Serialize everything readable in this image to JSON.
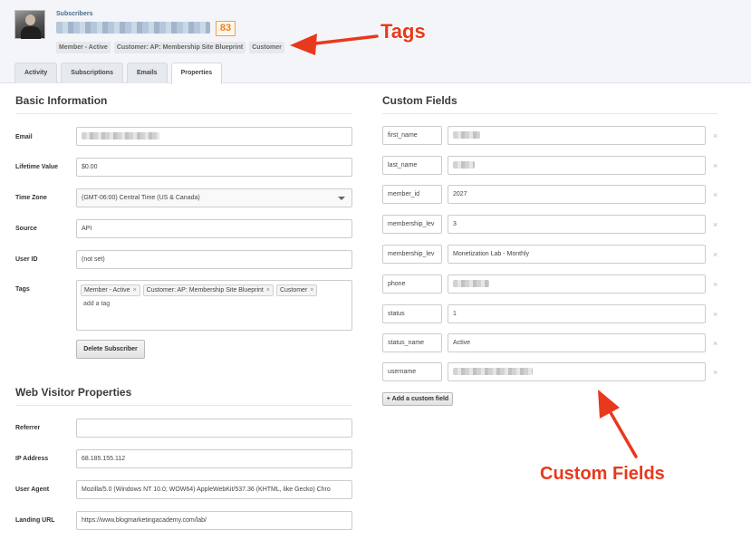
{
  "header": {
    "section_label": "Subscribers",
    "count": "83",
    "tags": [
      "Member - Active",
      "Customer: AP: Membership Site Blueprint",
      "Customer"
    ]
  },
  "annotations": {
    "tags": "Tags",
    "custom_fields": "Custom Fields",
    "color": "#e8391d"
  },
  "tabs": [
    "Activity",
    "Subscriptions",
    "Emails",
    "Properties"
  ],
  "active_tab": "Properties",
  "basic": {
    "title": "Basic Information",
    "email_label": "Email",
    "lifetime_label": "Lifetime Value",
    "lifetime_value": "$0.00",
    "timezone_label": "Time Zone",
    "timezone_value": "(GMT-06:00) Central Time (US & Canada)",
    "source_label": "Source",
    "source_value": "API",
    "userid_label": "User ID",
    "userid_value": "(not set)",
    "tags_label": "Tags",
    "tags": [
      "Member - Active",
      "Customer: AP: Membership Site Blueprint",
      "Customer"
    ],
    "add_tag_placeholder": "add a tag",
    "delete_button": "Delete Subscriber"
  },
  "web": {
    "title": "Web Visitor Properties",
    "referrer_label": "Referrer",
    "referrer_value": "",
    "ip_label": "IP Address",
    "ip_value": "68.185.155.112",
    "ua_label": "User Agent",
    "ua_value": "Mozilla/5.0 (Windows NT 10.0; WOW64) AppleWebKit/537.36 (KHTML, like Gecko) Chro",
    "landing_label": "Landing URL",
    "landing_value": "https://www.blogmarketingacademy.com/lab/"
  },
  "custom": {
    "title": "Custom Fields",
    "fields": [
      {
        "name": "first_name",
        "value": ""
      },
      {
        "name": "last_name",
        "value": ""
      },
      {
        "name": "member_id",
        "value": "2027"
      },
      {
        "name": "membership_lev",
        "value": "3"
      },
      {
        "name": "membership_lev",
        "value": "Monetization Lab - Monthly"
      },
      {
        "name": "phone",
        "value": ""
      },
      {
        "name": "status",
        "value": "1"
      },
      {
        "name": "status_name",
        "value": "Active"
      },
      {
        "name": "username",
        "value": ""
      }
    ],
    "remove_glyph": "×",
    "add_button": "+ Add a custom field"
  }
}
